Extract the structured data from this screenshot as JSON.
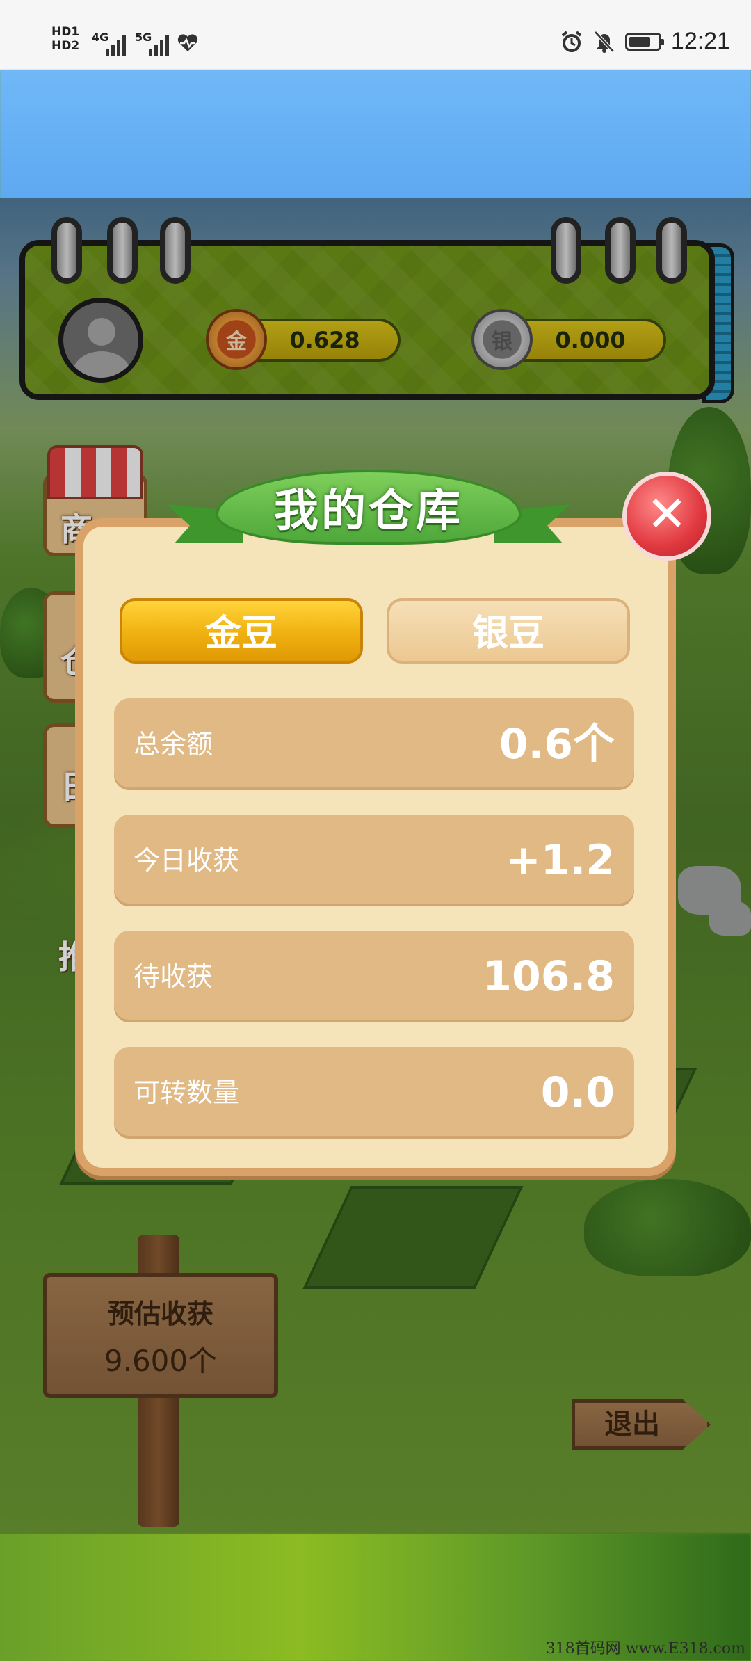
{
  "status_bar": {
    "hd1": "HD1",
    "hd2": "HD2",
    "net1": "4G",
    "net2": "5G",
    "time": "12:21",
    "icons": [
      "alarm-icon",
      "mute-bell-icon",
      "battery-icon",
      "heart-signal-icon"
    ]
  },
  "top_panel": {
    "gold_coin_symbol": "金",
    "gold_amount": "0.628",
    "silver_coin_symbol": "银",
    "silver_amount": "0.000"
  },
  "side_menu": {
    "shop_char": "商",
    "warehouse_char": "仓",
    "daily_char": "日",
    "other_char": "推"
  },
  "modal": {
    "title": "我的仓库",
    "close_symbol": "✕",
    "tabs": [
      {
        "label": "金豆",
        "active": true
      },
      {
        "label": "银豆",
        "active": false
      }
    ],
    "rows": [
      {
        "label": "总余额",
        "value": "0.6个"
      },
      {
        "label": "今日收获",
        "value": "+1.2"
      },
      {
        "label": "待收获",
        "value": "106.8"
      },
      {
        "label": "可转数量",
        "value": "0.0"
      }
    ]
  },
  "sign": {
    "title": "预估收获",
    "value": "9.600个"
  },
  "exit_label": "退出",
  "watermark": "318首码网 www.E318.com",
  "colors": {
    "gold_tab": "#f0b010",
    "modal_bg": "#f5e4ba",
    "row_bg": "#e0b985",
    "ribbon_green": "#4ea83a",
    "close_red": "#e0383f"
  }
}
